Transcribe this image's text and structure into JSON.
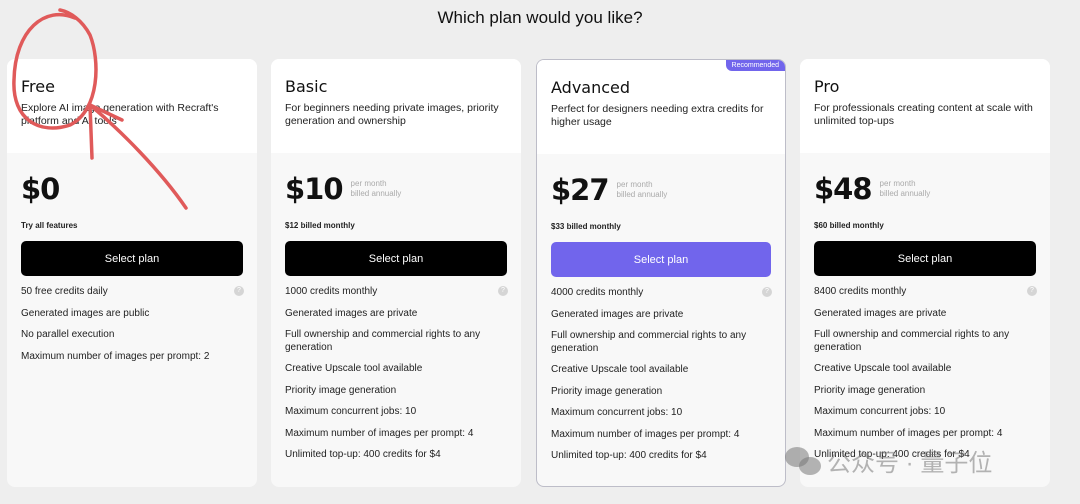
{
  "title": "Which plan would you like?",
  "plans": [
    {
      "name": "Free",
      "desc": "Explore AI image generation with Recraft's platform and AI tools",
      "price": "$0",
      "per": "",
      "billed": "",
      "sub": "Try all features",
      "button": "Select plan",
      "features": [
        "50 free credits daily",
        "Generated images are public",
        "No parallel execution",
        "Maximum number of images per prompt: 2"
      ]
    },
    {
      "name": "Basic",
      "desc": "For beginners needing private images, priority generation and ownership",
      "price": "$10",
      "per": "per month",
      "billed": "billed annually",
      "sub": "$12 billed monthly",
      "button": "Select plan",
      "features": [
        "1000 credits monthly",
        "Generated images are private",
        "Full ownership and commercial rights to any generation",
        "Creative Upscale tool available",
        "Priority image generation",
        "Maximum concurrent jobs: 10",
        "Maximum number of images per prompt: 4",
        "Unlimited top-up: 400 credits for $4"
      ]
    },
    {
      "name": "Advanced",
      "badge": "Recommended",
      "desc": "Perfect for designers needing extra credits for higher usage",
      "price": "$27",
      "per": "per month",
      "billed": "billed annually",
      "sub": "$33 billed monthly",
      "button": "Select plan",
      "features": [
        "4000 credits monthly",
        "Generated images are private",
        "Full ownership and commercial rights to any generation",
        "Creative Upscale tool available",
        "Priority image generation",
        "Maximum concurrent jobs: 10",
        "Maximum number of images per prompt: 4",
        "Unlimited top-up: 400 credits for $4"
      ]
    },
    {
      "name": "Pro",
      "desc": "For professionals creating content at scale with unlimited top-ups",
      "price": "$48",
      "per": "per month",
      "billed": "billed annually",
      "sub": "$60 billed monthly",
      "button": "Select plan",
      "features": [
        "8400 credits monthly",
        "Generated images are private",
        "Full ownership and commercial rights to any generation",
        "Creative Upscale tool available",
        "Priority image generation",
        "Maximum concurrent jobs: 10",
        "Maximum number of images per prompt: 4",
        "Unlimited top-up: 400 credits for $4"
      ]
    }
  ],
  "help_icon": "?",
  "colors": {
    "accent": "#7165ec",
    "annotation": "#e05050"
  },
  "watermark": "公众号 · 量子位"
}
